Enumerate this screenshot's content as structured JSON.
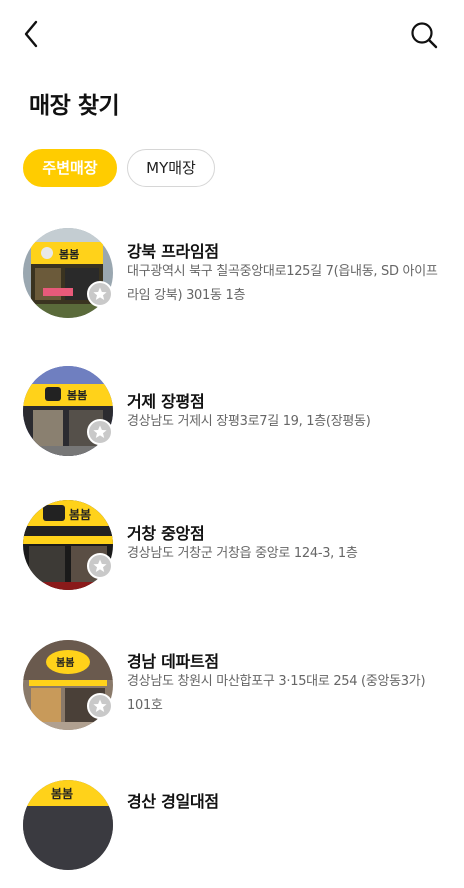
{
  "header": {
    "back_icon": "chevron-left-icon",
    "search_icon": "search-icon"
  },
  "page": {
    "title": "매장 찾기"
  },
  "tabs": [
    {
      "label": "주변매장",
      "selected": true
    },
    {
      "label": "MY매장",
      "selected": false
    }
  ],
  "colors": {
    "accent": "#ffcc00",
    "address": "#666666",
    "favorite_badge": "#c9c9c9"
  },
  "stores": [
    {
      "name": "강북 프라임점",
      "address": "대구광역시 북구 칠곡중앙대로125길 7(읍내동, SD 아이프라임 강북) 301동 1층",
      "photo_sign": "봄봄"
    },
    {
      "name": "거제 장평점",
      "address": "경상남도 거제시 장평3로7길 19, 1층(장평동)",
      "photo_sign": "봄봄"
    },
    {
      "name": "거창 중앙점",
      "address": "경상남도 거창군 거창읍 중앙로 124-3, 1층",
      "photo_sign": "봄봄"
    },
    {
      "name": "경남 데파트점",
      "address": "경상남도 창원시 마산합포구 3·15대로 254 (중앙동3가) 101호",
      "photo_sign": "봄봄"
    },
    {
      "name": "경산 경일대점",
      "address": "",
      "photo_sign": "봄봄"
    }
  ]
}
